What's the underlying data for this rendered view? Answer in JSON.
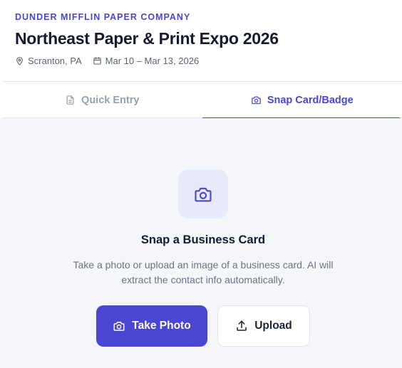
{
  "header": {
    "company": "DUNDER MIFFLIN PAPER COMPANY",
    "event_title": "Northeast Paper & Print Expo 2026",
    "location": "Scranton, PA",
    "dates": "Mar 10 – Mar 13, 2026"
  },
  "tabs": [
    {
      "label": "Quick Entry",
      "icon": "document-icon",
      "active": false
    },
    {
      "label": "Snap Card/Badge",
      "icon": "camera-icon",
      "active": true
    }
  ],
  "snap_panel": {
    "icon": "camera-icon",
    "heading": "Snap a Business Card",
    "description": "Take a photo or upload an image of a business card. AI will extract the contact info automatically.",
    "take_photo_label": "Take Photo",
    "upload_label": "Upload"
  },
  "colors": {
    "accent": "#4b45d4",
    "panel_background": "#f5f6fa",
    "icon_tile": "#e8e9fb"
  }
}
